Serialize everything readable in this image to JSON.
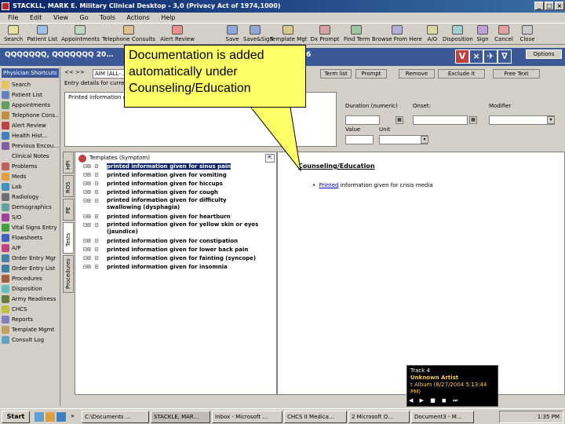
{
  "window": {
    "title": "STACKLL, MARK E. Military Clinical Desktop - 3,0 (Privacy Act of 1974,1000)",
    "min": "_",
    "max": "□",
    "close": "×"
  },
  "menu": [
    "File",
    "Edit",
    "View",
    "Go",
    "Tools",
    "Actions",
    "Help"
  ],
  "toolbar": {
    "left": [
      "Search",
      "Patient List",
      "Appointments",
      "Telephone Consults",
      "Alert Review"
    ],
    "right": [
      "Save",
      "Save&Sign",
      "Template Mgt",
      "Dx Prompt",
      "Find Term",
      "Browse From Here",
      "A/O",
      "Disposition",
      "Sign",
      "Cancel",
      "Close"
    ]
  },
  "banner": {
    "patient_name": "QQQQQQQ, QQQQQQQ 20…",
    "age_fragment": "6",
    "icons": [
      "V",
      "×",
      "✈",
      "∇"
    ],
    "options_label": "Options"
  },
  "shortcuts": {
    "header": "Physician Shortcuts",
    "items": [
      "Search",
      "Patient List",
      "Appointments",
      "Telephone Cons…",
      "Alert Review",
      "Health Hist…",
      "Previous Encou…",
      "Clinical Notes",
      "Problems",
      "Meds",
      "Lab",
      "Radiology",
      "Demographics",
      "S/O",
      "Vital Signs Entry",
      "Flowsheets",
      "A/P",
      "Order Entry Mgr",
      "Order Entry List",
      "Procedures",
      "Disposition",
      "Army Readiness",
      "CHCS",
      "Reports",
      "Template Mgmt",
      "Consult Log"
    ]
  },
  "entry": {
    "filter_text": "AIM (ALL-…",
    "entry_details_label": "Entry details for current …",
    "item_text": "Printed information g…",
    "termlist_label": "Term list",
    "prompt_label": "Prompt",
    "remove_label": "Remove",
    "exclude_label": "Exclude it",
    "free_text_label": "Free Text",
    "duration_label": "Duration (numeric)",
    "onset_label": "Onset:",
    "modifier_label": "Modifier",
    "value_label": "Value",
    "unit_label": "Unit"
  },
  "templates": {
    "header": "Templates (Symptom)",
    "tabs": [
      "HPI",
      "ROS",
      "PE",
      "Tests",
      "Procedures"
    ],
    "items": [
      "printed information given for sinus pain",
      "printed information given for vomiting",
      "printed information given for hiccups",
      "printed information given for cough",
      "printed information given for difficulty swallowing (dysphagia)",
      "printed information given for heartburn",
      "printed information given for yellow skin or eyes (jaundice)",
      "printed information given for constipation",
      "printed information given for lower back pain",
      "printed information given for fainting (syncope)",
      "printed information given for insomnia"
    ]
  },
  "output": {
    "heading": "Counseling/Education",
    "bullet_link": "Printed",
    "bullet_text": " information given for crisis media"
  },
  "callout": {
    "text": "Documentation is added automatically under Counseling/Education"
  },
  "media": {
    "track": "Track 4",
    "artist": "Unknown Artist",
    "album": "t Album (8/27/2004 5:13:44 PM)"
  },
  "taskbar": {
    "start": "Start",
    "tasks": [
      "C:\\Documents …",
      "STACKLE, MAR…",
      "Inbox - Microsoft …",
      "CHCS II Medica…",
      "2 Microsoft O…",
      "Document3 - M…"
    ],
    "clock": "1:35 PM"
  },
  "colors": {
    "title_bar": "#0a246a",
    "banner": "#3b5998",
    "callout": "#ffff66"
  }
}
